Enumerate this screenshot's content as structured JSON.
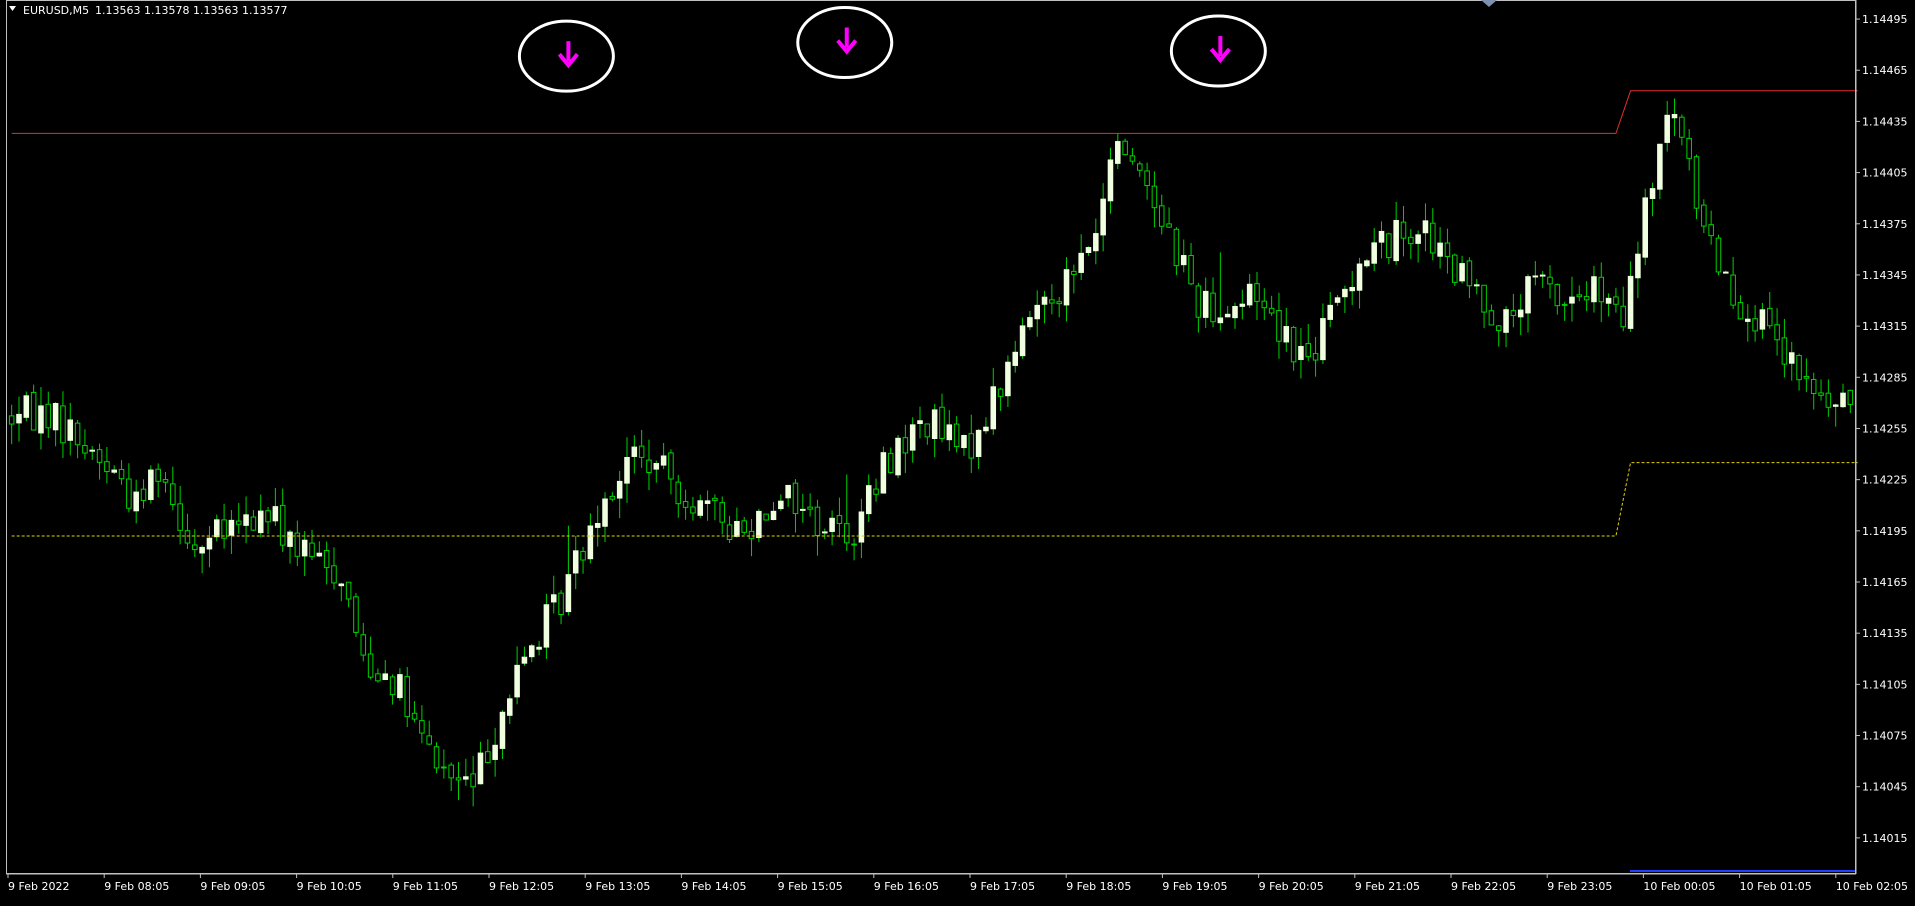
{
  "header": {
    "symbol_timeframe": "EURUSD,M5",
    "ohlc": "1.13563 1.13578 1.13563 1.13577"
  },
  "colors": {
    "background": "#000000",
    "frame": "#c0c0c0",
    "bull_body": "#f0ffe0",
    "wick": "#00d000",
    "resistance_line": "#e03030",
    "support_line": "#e0d000",
    "arrow": "#ff00ff",
    "marker_circle": "#ffffff",
    "axis_text": "#ffffff",
    "blue_line": "#2040ff"
  },
  "icons": {
    "menu_triangle": "dropdown-triangle-icon",
    "sell_arrow": "down-arrow-icon"
  },
  "chart_data": {
    "type": "candlestick",
    "grid": false,
    "ylim": [
      1.13995,
      1.14505
    ],
    "y_ticks": [
      "1.14495",
      "1.14465",
      "1.14435",
      "1.14405",
      "1.14375",
      "1.14345",
      "1.14315",
      "1.14285",
      "1.14255",
      "1.14225",
      "1.14195",
      "1.14165",
      "1.14135",
      "1.14105",
      "1.14075",
      "1.14045",
      "1.14015"
    ],
    "y_tick_values": [
      1.14495,
      1.14465,
      1.14435,
      1.14405,
      1.14375,
      1.14345,
      1.14315,
      1.14285,
      1.14255,
      1.14225,
      1.14195,
      1.14165,
      1.14135,
      1.14105,
      1.14075,
      1.14045,
      1.14015
    ],
    "x_ticks": [
      "9 Feb 2022",
      "9 Feb 08:05",
      "9 Feb 09:05",
      "9 Feb 10:05",
      "9 Feb 11:05",
      "9 Feb 12:05",
      "9 Feb 13:05",
      "9 Feb 14:05",
      "9 Feb 15:05",
      "9 Feb 16:05",
      "9 Feb 17:05",
      "9 Feb 18:05",
      "9 Feb 19:05",
      "9 Feb 20:05",
      "9 Feb 21:05",
      "9 Feb 22:05",
      "9 Feb 23:05",
      "10 Feb 00:05",
      "10 Feb 01:05",
      "10 Feb 02:05"
    ],
    "bar_count": 252,
    "candles": {
      "close_path": [
        [
          0,
          1.14262
        ],
        [
          5,
          1.14265
        ],
        [
          10,
          1.14245
        ],
        [
          15,
          1.14225
        ],
        [
          17,
          1.1421
        ],
        [
          20,
          1.14235
        ],
        [
          25,
          1.14185
        ],
        [
          30,
          1.14195
        ],
        [
          35,
          1.14205
        ],
        [
          40,
          1.1418
        ],
        [
          45,
          1.1417
        ],
        [
          48,
          1.1412
        ],
        [
          52,
          1.1411
        ],
        [
          56,
          1.1407
        ],
        [
          60,
          1.1405
        ],
        [
          63,
          1.14045
        ],
        [
          66,
          1.1408
        ],
        [
          70,
          1.1412
        ],
        [
          75,
          1.14155
        ],
        [
          80,
          1.1421
        ],
        [
          85,
          1.1424
        ],
        [
          90,
          1.14225
        ],
        [
          95,
          1.14205
        ],
        [
          100,
          1.14195
        ],
        [
          105,
          1.1422
        ],
        [
          110,
          1.142
        ],
        [
          115,
          1.14195
        ],
        [
          120,
          1.1424
        ],
        [
          125,
          1.1426
        ],
        [
          130,
          1.1424
        ],
        [
          135,
          1.1428
        ],
        [
          140,
          1.1433
        ],
        [
          145,
          1.14345
        ],
        [
          149,
          1.1438
        ],
        [
          150,
          1.14415
        ],
        [
          152,
          1.1442
        ],
        [
          155,
          1.144
        ],
        [
          158,
          1.1437
        ],
        [
          162,
          1.1433
        ],
        [
          166,
          1.14325
        ],
        [
          170,
          1.14335
        ],
        [
          174,
          1.1431
        ],
        [
          177,
          1.14295
        ],
        [
          180,
          1.1432
        ],
        [
          184,
          1.14355
        ],
        [
          188,
          1.14365
        ],
        [
          192,
          1.14375
        ],
        [
          196,
          1.1435
        ],
        [
          200,
          1.14335
        ],
        [
          204,
          1.14315
        ],
        [
          208,
          1.1434
        ],
        [
          212,
          1.1433
        ],
        [
          216,
          1.14335
        ],
        [
          220,
          1.14315
        ],
        [
          223,
          1.1438
        ],
        [
          225,
          1.1442
        ],
        [
          227,
          1.1444
        ],
        [
          229,
          1.14405
        ],
        [
          232,
          1.14365
        ],
        [
          235,
          1.14335
        ],
        [
          238,
          1.1432
        ],
        [
          242,
          1.14295
        ],
        [
          246,
          1.14275
        ],
        [
          250,
          1.14265
        ],
        [
          253,
          1.14295
        ]
      ],
      "note": "5-minute candles, approximately 252 bars from 9 Feb 07:05 to 10 Feb 02:05"
    },
    "overlays": [
      {
        "name": "",
        "kind": "step",
        "color": "resistance",
        "segments": [
          [
            0,
            1.14428
          ],
          [
            219,
            1.14428
          ],
          [
            221,
            1.14453
          ],
          [
            252,
            1.14453
          ]
        ]
      },
      {
        "name": "",
        "kind": "step-dashed",
        "color": "support",
        "segments": [
          [
            0,
            1.14192
          ],
          [
            219,
            1.14192
          ],
          [
            221,
            1.14235
          ],
          [
            252,
            1.14235
          ]
        ]
      }
    ],
    "sell_signals": [
      {
        "bar": 76,
        "price": 1.14475
      },
      {
        "bar": 114,
        "price": 1.14483
      },
      {
        "bar": 165,
        "price": 1.14478
      }
    ]
  }
}
